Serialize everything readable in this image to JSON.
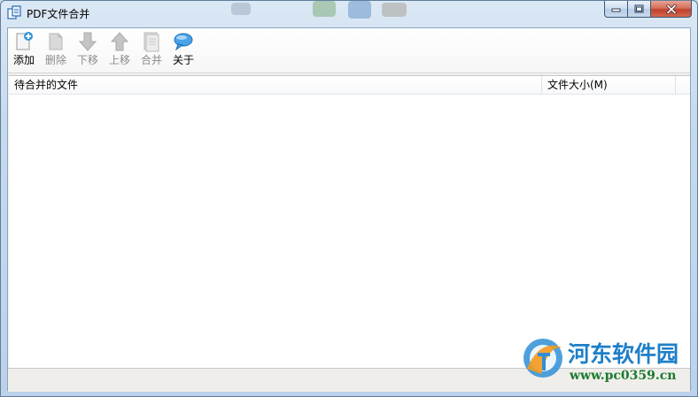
{
  "window": {
    "title": "PDF文件合并"
  },
  "toolbar": {
    "buttons": [
      {
        "label": "添加",
        "icon": "add-file-icon",
        "enabled": true
      },
      {
        "label": "删除",
        "icon": "delete-file-icon",
        "enabled": false
      },
      {
        "label": "下移",
        "icon": "arrow-down-icon",
        "enabled": false
      },
      {
        "label": "上移",
        "icon": "arrow-up-icon",
        "enabled": false
      },
      {
        "label": "合并",
        "icon": "merge-icon",
        "enabled": false
      },
      {
        "label": "关于",
        "icon": "speech-bubble-icon",
        "enabled": true
      }
    ]
  },
  "list": {
    "columns": [
      {
        "label": "待合并的文件"
      },
      {
        "label": "文件大小(M)"
      }
    ],
    "rows": []
  },
  "watermark": {
    "name": "河东软件园",
    "url": "www.pc0359.cn"
  },
  "colors": {
    "accent": "#1e7fc8",
    "close_button": "#c0412b",
    "watermark_green": "#1a7a2e"
  }
}
